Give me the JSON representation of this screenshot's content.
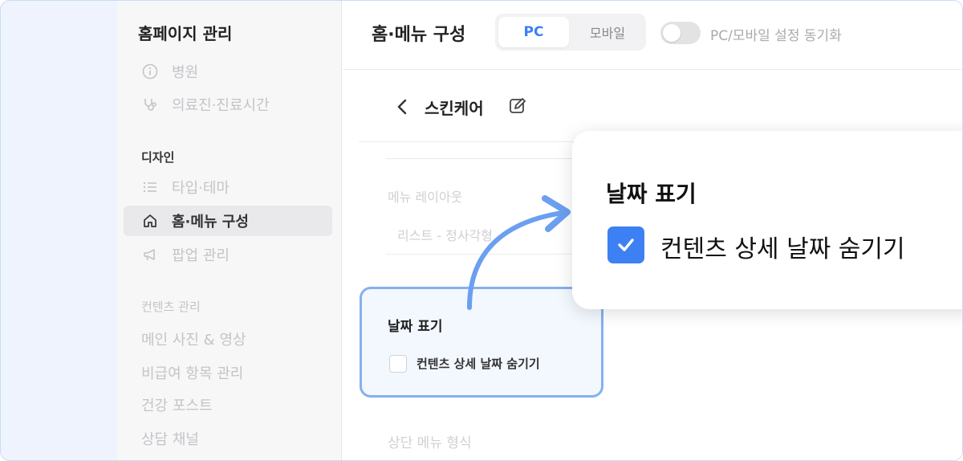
{
  "sidebar": {
    "title": "홈페이지 관리",
    "items_top": [
      {
        "label": "병원",
        "icon": "info-circle-icon"
      },
      {
        "label": "의료진·진료시간",
        "icon": "stethoscope-icon"
      }
    ],
    "design_section": "디자인",
    "design_items": [
      {
        "label": "타입·테마",
        "icon": "list-icon"
      },
      {
        "label": "홈·메뉴 구성",
        "icon": "home-icon",
        "active": true
      },
      {
        "label": "팝업 관리",
        "icon": "megaphone-icon"
      }
    ],
    "content_section": "컨텐츠 관리",
    "content_items": [
      "메인 사진 & 영상",
      "비급여 항목 관리",
      "건강 포스트",
      "상담 채널"
    ]
  },
  "topbar": {
    "title": "홈·메뉴 구성",
    "tab_pc": "PC",
    "tab_mobile": "모바일",
    "sync_label": "PC/모바일 설정 동기화"
  },
  "content": {
    "header_title": "스킨케어",
    "menu_layout_label": "메뉴 레이아웃",
    "menu_layout_value": "리스트 - 정사각형",
    "top_menu_label": "상단 메뉴 형식"
  },
  "date_card": {
    "title": "날짜 표기",
    "checkbox_label": "컨텐츠 상세 날짜 숨기기",
    "checked": false
  },
  "popup": {
    "title": "날짜 표기",
    "checkbox_label": "컨텐츠 상세 날짜 숨기기",
    "checked": true
  },
  "colors": {
    "accent": "#3d80f3",
    "highlight_border": "#86b0ee",
    "left_strip": "#eef3fd"
  }
}
